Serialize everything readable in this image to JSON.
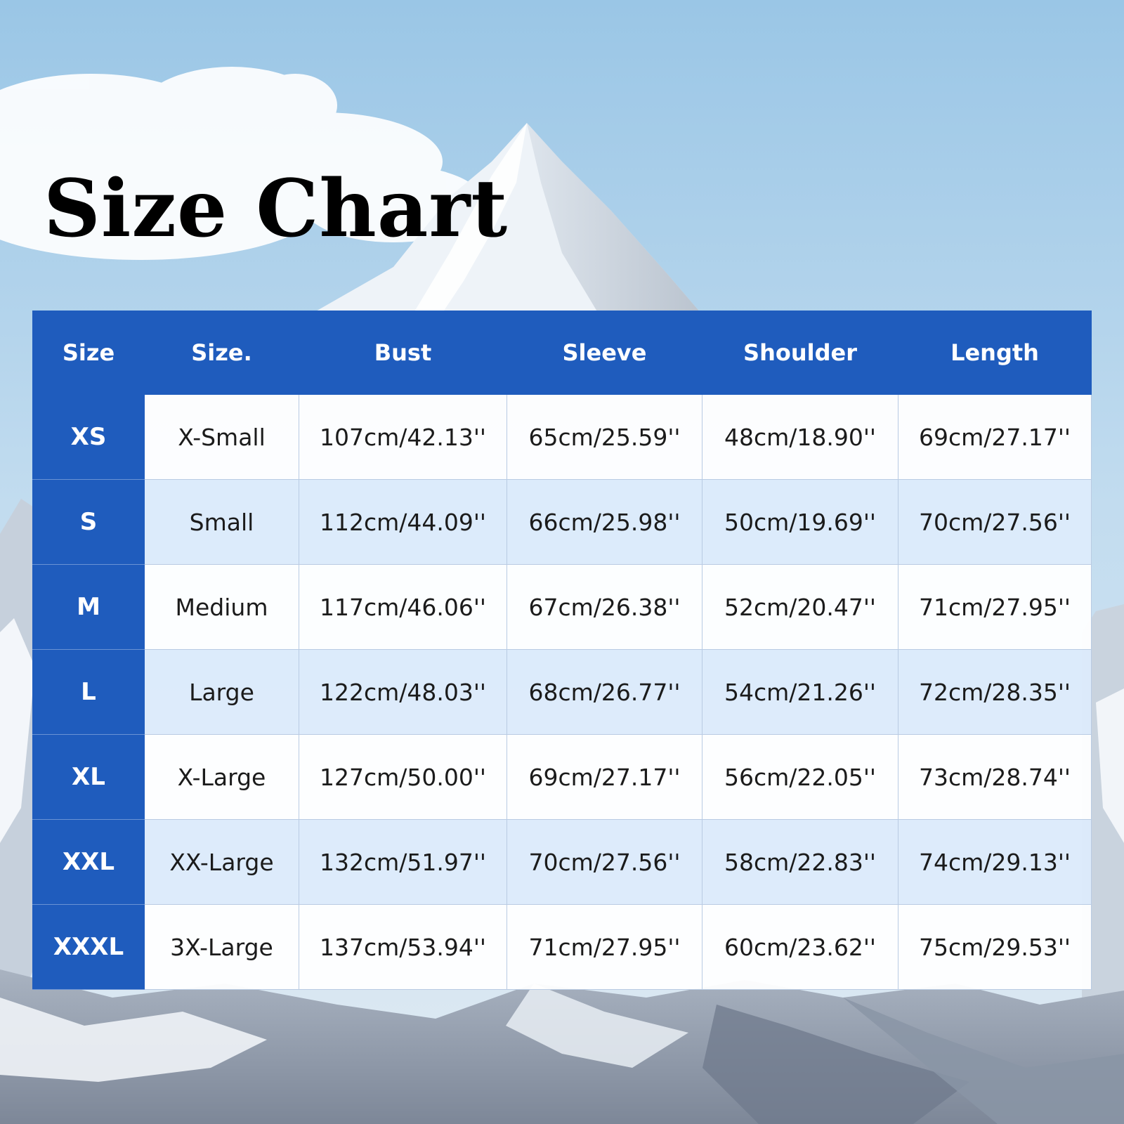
{
  "title": "Size Chart",
  "colors": {
    "header_blue": "#1f5cbd",
    "sky_top": "#9fc8e6",
    "sky_bottom": "#d7e8f3"
  },
  "table": {
    "headers": [
      "Size",
      "Size.",
      "Bust",
      "Sleeve",
      "Shoulder",
      "Length"
    ],
    "rows": [
      [
        "XS",
        "X-Small",
        "107cm/42.13''",
        "65cm/25.59''",
        "48cm/18.90''",
        "69cm/27.17''"
      ],
      [
        "S",
        "Small",
        "112cm/44.09''",
        "66cm/25.98''",
        "50cm/19.69''",
        "70cm/27.56''"
      ],
      [
        "M",
        "Medium",
        "117cm/46.06''",
        "67cm/26.38''",
        "52cm/20.47''",
        "71cm/27.95''"
      ],
      [
        "L",
        "Large",
        "122cm/48.03''",
        "68cm/26.77''",
        "54cm/21.26''",
        "72cm/28.35''"
      ],
      [
        "XL",
        "X-Large",
        "127cm/50.00''",
        "69cm/27.17''",
        "56cm/22.05''",
        "73cm/28.74''"
      ],
      [
        "XXL",
        "XX-Large",
        "132cm/51.97''",
        "70cm/27.56''",
        "58cm/22.83''",
        "74cm/29.13''"
      ],
      [
        "XXXL",
        "3X-Large",
        "137cm/53.94''",
        "71cm/27.95''",
        "60cm/23.62''",
        "75cm/29.53''"
      ]
    ]
  }
}
